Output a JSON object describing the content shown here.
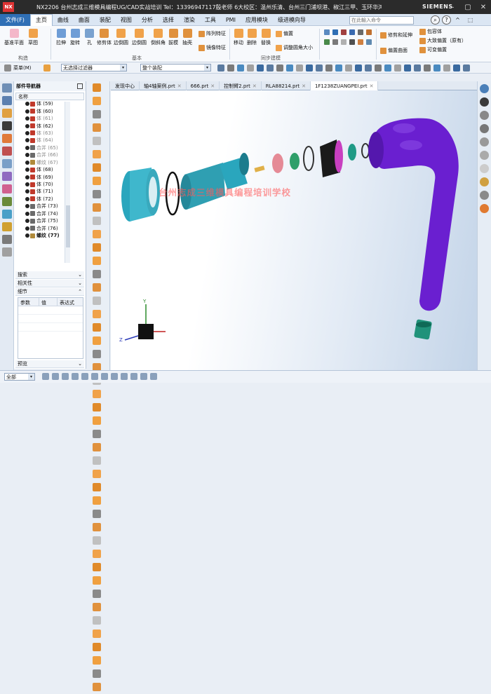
{
  "window": {
    "app_icon": "NX",
    "title": "NX2206 台州志成三维模具编程UG/CAD实战培训  Tel：13396947117殷老师 6大校区：温州乐清、台州三门浦坝港、椒江三甲、玉环华鸿、玉环沙门、玉环坎门 - 建模",
    "brand": "SIEMENS"
  },
  "menu": {
    "file": "文件(F)",
    "tabs": [
      "主页",
      "曲线",
      "曲面",
      "装配",
      "视图",
      "分析",
      "选择",
      "渲染",
      "工具",
      "PMI",
      "应用模块",
      "级进模向导"
    ],
    "active_tab": "主页",
    "search_placeholder": "在此輸入命令"
  },
  "ribbon": {
    "big_buttons": [
      "基准平面",
      "草图",
      "拉伸",
      "旋转",
      "孔",
      "修剪体",
      "边倒圆",
      "边倒圆",
      "倒斜角",
      "拔模",
      "抽壳",
      "移动",
      "删除",
      "替换"
    ],
    "small_buttons": [
      "阵列特征",
      "镜像特征",
      "偏置",
      "调整圆角大小",
      "修剪和延伸",
      "偏置曲面",
      "包容体",
      "大致偏置（原有）",
      "可变偏置"
    ],
    "groups": [
      "构造",
      "基本",
      "同步建模"
    ]
  },
  "toolbar": {
    "menu_label": "菜单(M)",
    "filter": "无选择过滤器",
    "scope": "整个装配"
  },
  "navigator": {
    "title": "部件导航器",
    "column": "名称",
    "items": [
      {
        "label": "体 (59)",
        "dim": false,
        "bold": false
      },
      {
        "label": "体 (60)",
        "dim": false,
        "bold": false
      },
      {
        "label": "体 (61)",
        "dim": true,
        "bold": false
      },
      {
        "label": "体 (62)",
        "dim": false,
        "bold": false
      },
      {
        "label": "体 (63)",
        "dim": true,
        "bold": false
      },
      {
        "label": "体 (64)",
        "dim": true,
        "bold": false
      },
      {
        "label": "合并 (65)",
        "dim": true,
        "bold": false
      },
      {
        "label": "合并 (66)",
        "dim": true,
        "bold": false
      },
      {
        "label": "螺纹 (67)",
        "dim": true,
        "bold": false
      },
      {
        "label": "体 (68)",
        "dim": false,
        "bold": false
      },
      {
        "label": "体 (69)",
        "dim": false,
        "bold": false
      },
      {
        "label": "体 (70)",
        "dim": false,
        "bold": false
      },
      {
        "label": "体 (71)",
        "dim": false,
        "bold": false
      },
      {
        "label": "体 (72)",
        "dim": false,
        "bold": false
      },
      {
        "label": "合并 (73)",
        "dim": false,
        "bold": false
      },
      {
        "label": "合并 (74)",
        "dim": false,
        "bold": false
      },
      {
        "label": "合并 (75)",
        "dim": false,
        "bold": false
      },
      {
        "label": "合并 (76)",
        "dim": false,
        "bold": false
      },
      {
        "label": "螺纹 (77)",
        "dim": false,
        "bold": true
      }
    ],
    "sections": [
      "搜索",
      "相关性",
      "细节"
    ],
    "detail_columns": [
      "参数",
      "值",
      "表达式"
    ],
    "preview": "预览"
  },
  "doc_tabs": [
    {
      "label": "发现中心",
      "active": false
    },
    {
      "label": "轴4轴案例.prt",
      "active": false
    },
    {
      "label": "666.prt",
      "active": false
    },
    {
      "label": "控制臂2.prt",
      "active": false
    },
    {
      "label": "RLA88214.prt",
      "active": false
    },
    {
      "label": "1F1238ZUANGPEI.prt",
      "active": true
    }
  ],
  "viewport": {
    "watermark": "台州志成三维模具编程培训学校",
    "triad": {
      "y": "Y",
      "z": "Z"
    }
  },
  "status": {
    "selection": "全部"
  },
  "colors": {
    "accent": "#2f6fb5",
    "part_cyan": "#2aa6bd",
    "part_purple": "#6a1fd0",
    "part_green": "#20927a",
    "part_pink": "#e58a96",
    "part_magenta": "#c83fc0"
  }
}
